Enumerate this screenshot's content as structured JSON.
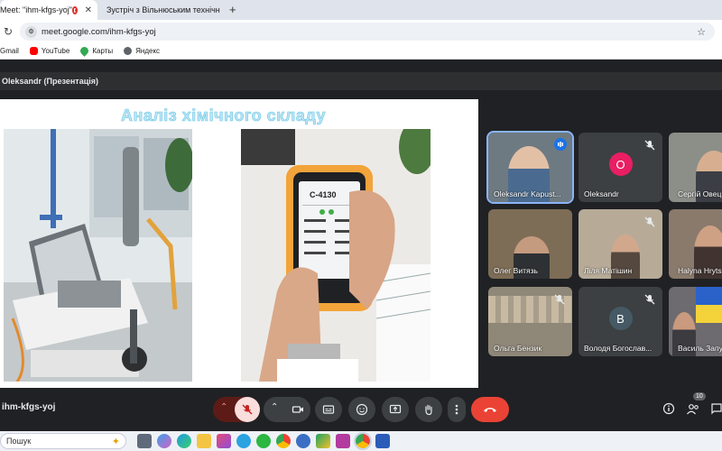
{
  "browser": {
    "tabs": [
      {
        "label": "Meet: \"ihm-kfgs-yoj\"",
        "active": true
      },
      {
        "label": "Зустріч з Вільнюським технічн",
        "active": false
      }
    ],
    "new_tab_symbol": "+",
    "url": "meet.google.com/ihm-kfgs-yoj",
    "bookmarks": [
      "Gmail",
      "YouTube",
      "Карты",
      "Яндекс"
    ]
  },
  "presentation": {
    "header": "Oleksandr (Презентація)",
    "slide_title": "Аналіз хімічного складу",
    "device_reading": "C-4130"
  },
  "participants": [
    {
      "name": "Oleksandr Kapust...",
      "speaking": true,
      "muted": false
    },
    {
      "name": "Oleksandr",
      "avatar_letter": "O",
      "avatar_color": "#e91e63",
      "muted": true
    },
    {
      "name": "Сергій Овець",
      "muted": false
    },
    {
      "name": "Олег Витязь",
      "muted": false
    },
    {
      "name": "Ліля Матішин",
      "muted": true
    },
    {
      "name": "Halyna Hryts",
      "muted": false
    },
    {
      "name": "Ольга Бензик",
      "muted": true
    },
    {
      "name": "Володя Богослав...",
      "avatar_letter": "B",
      "avatar_color": "#455a64",
      "muted": true
    },
    {
      "name": "Василь Запу",
      "muted": false
    }
  ],
  "bottom_bar": {
    "meeting_code": "ihm-kfgs-yoj",
    "participant_count": "10"
  },
  "taskbar": {
    "search_placeholder": "Пошук"
  },
  "colors": {
    "end_call": "#ea4335",
    "mic_muted_bg": "#f9dedc",
    "accent_blue": "#1a73e8"
  }
}
